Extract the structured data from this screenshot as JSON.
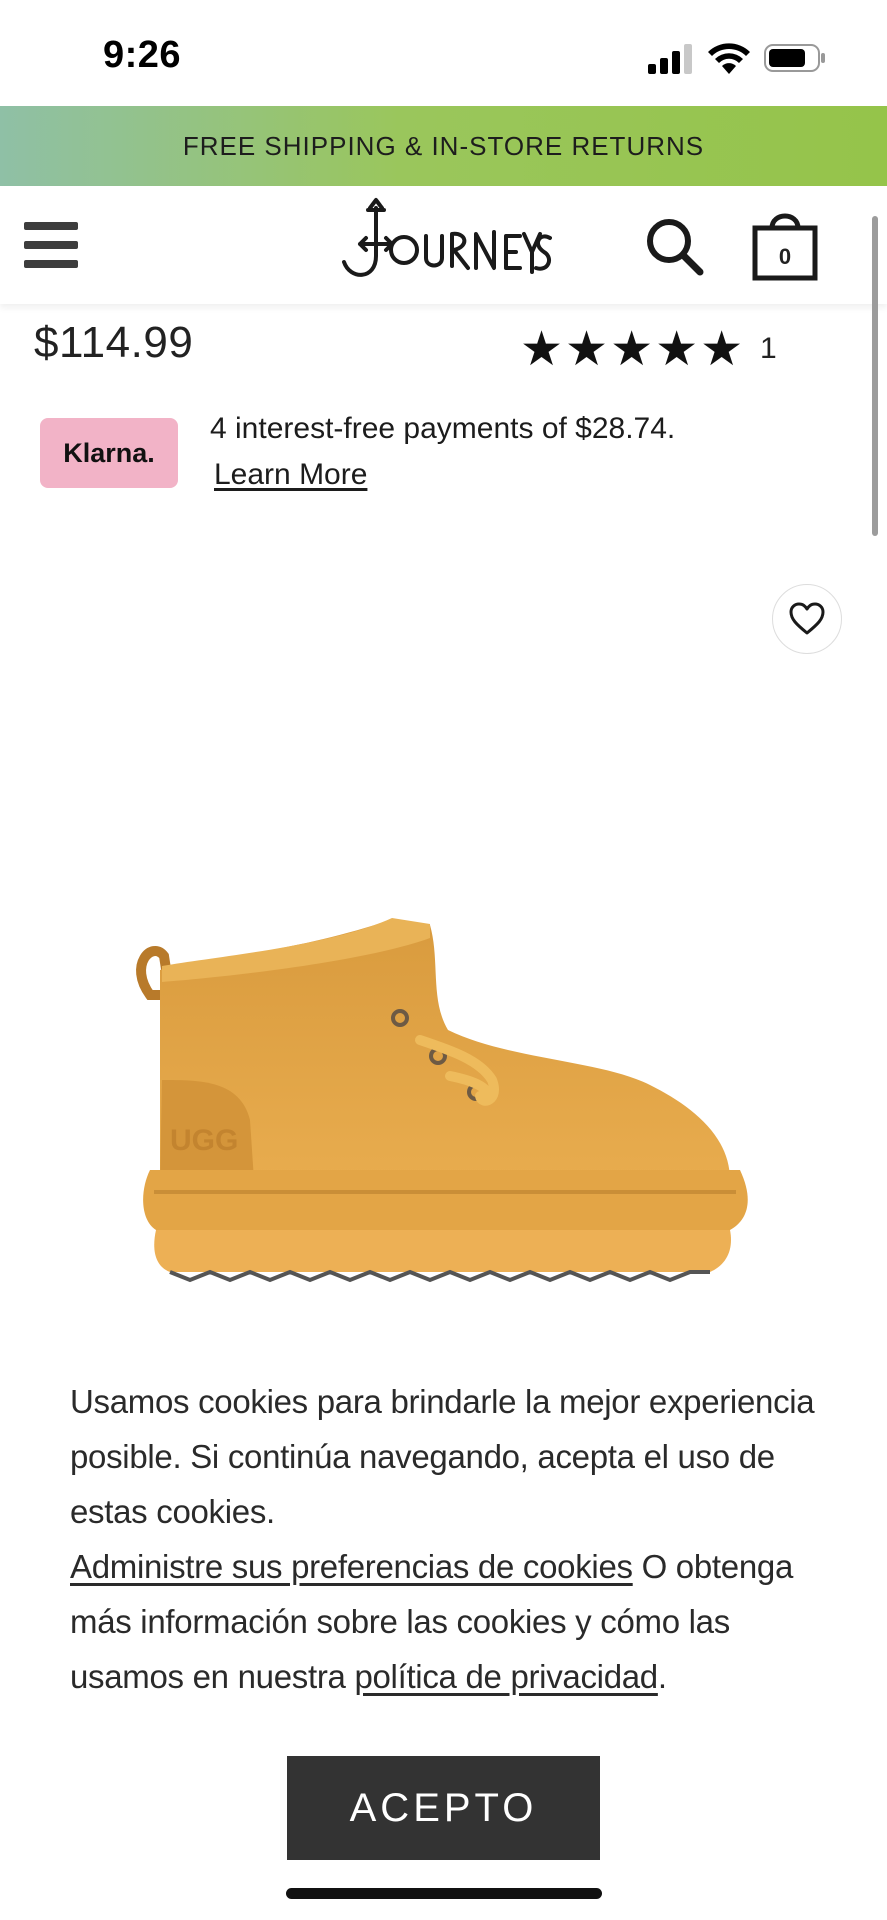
{
  "status_bar": {
    "time": "9:26"
  },
  "promo": {
    "text": "FREE SHIPPING & IN-STORE RETURNS"
  },
  "header": {
    "logo_alt": "Journeys",
    "cart_count": "0"
  },
  "product": {
    "price": "$114.99",
    "rating": {
      "stars": 5,
      "max": 5,
      "count": "1"
    },
    "image_brand_text": "UGG",
    "boot_color": "#e3a546"
  },
  "klarna": {
    "badge": "Klarna.",
    "text": "4 interest-free payments of $28.74.",
    "link": "Learn More",
    "badge_color": "#f2b3c7"
  },
  "cookie_banner": {
    "line1": "Usamos cookies para brindarle la mejor experiencia posible. Si continúa navegando, acepta el uso de estas cookies.",
    "manage_link": "Administre sus preferencias de cookies",
    "middle": " O obtenga más información sobre las cookies y cómo las usamos en nuestra ",
    "privacy_link": "política de privacidad",
    "end": ".",
    "accept_label": "ACEPTO"
  },
  "colors": {
    "promo_green": "#9ac65c",
    "button_dark": "#333333"
  }
}
